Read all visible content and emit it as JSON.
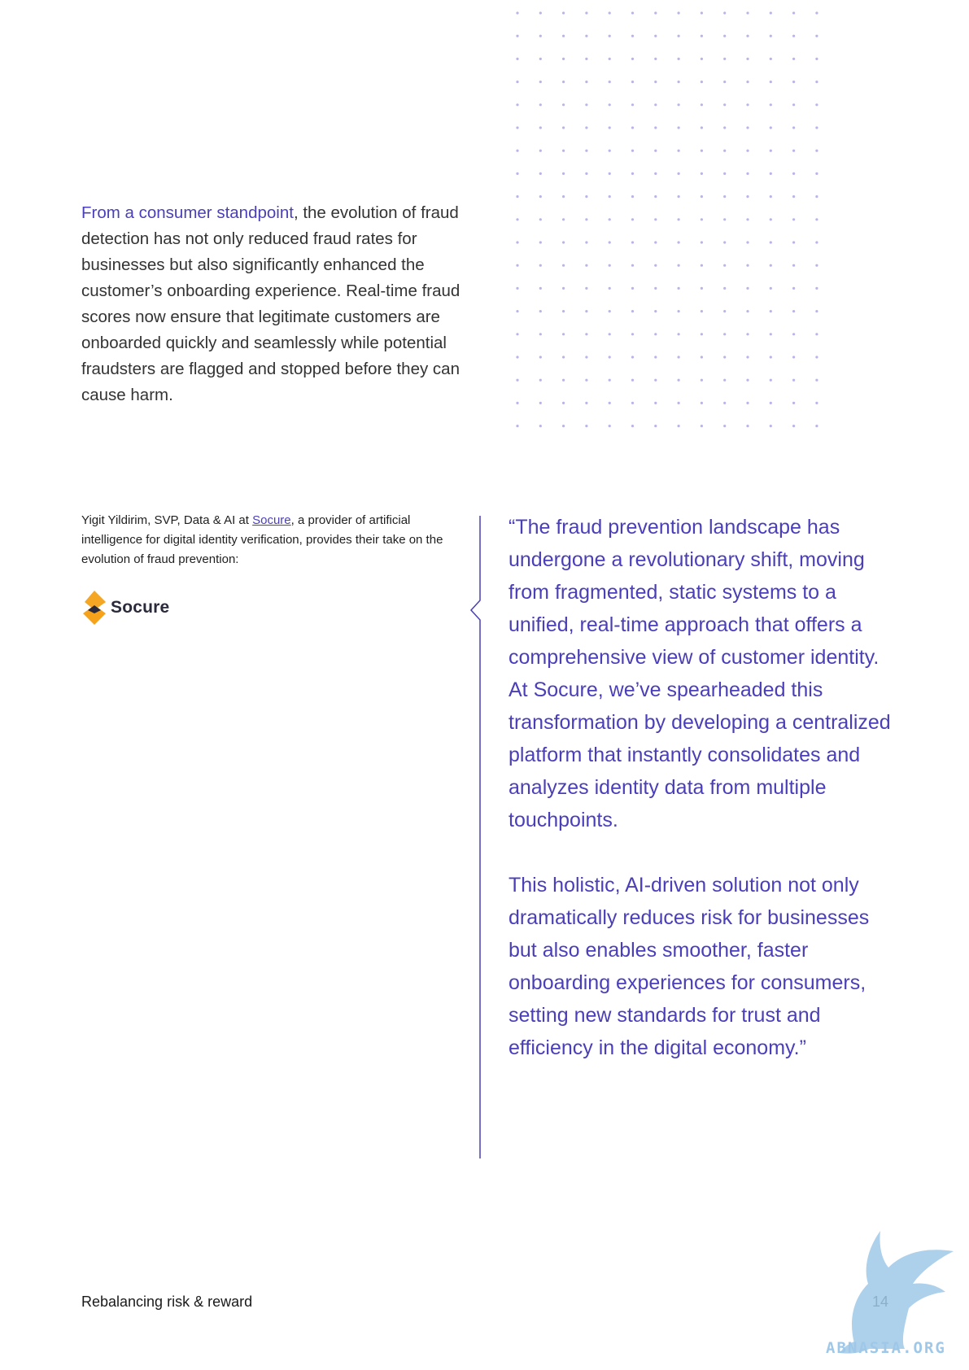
{
  "intro": {
    "lead": "From a consumer standpoint",
    "rest": ", the evolution of fraud detection has not only reduced fraud rates for businesses but also significantly enhanced the customer’s onboarding experience. Real-time fraud scores now ensure that legitimate customers are onboarded quickly and seamlessly while potential fraudsters are flagged and stopped before they can cause harm."
  },
  "attribution": {
    "before": "Yigit Yildirim, SVP, Data & AI at ",
    "link": "Socure",
    "after": ", a provider of artificial intelligence for digital identity verification, provides their take on the evolution of fraud prevention:"
  },
  "logo": {
    "name": "Socure",
    "mark_colors": [
      "#f5a623",
      "#f7c04a"
    ]
  },
  "quote": {
    "paragraph1": "“The fraud prevention landscape has undergone a revolutionary shift, moving from fragmented, static systems to a unified, real-time approach that offers a comprehensive view of customer identity. At Socure, we’ve spearheaded this transformation by developing a centralized platform that instantly consolidates and analyzes identity data from multiple touchpoints.",
    "paragraph2": "This holistic, AI-driven solution not only dramatically reduces risk for businesses but also enables smoother, faster onboarding experiences for consumers, setting new standards for trust and efficiency in the digital economy.”"
  },
  "footer": {
    "title": "Rebalancing risk & reward",
    "page_number": "14"
  },
  "watermark": {
    "text": "ABNASIA.ORG",
    "icon": "griffin-icon"
  },
  "colors": {
    "accent": "#4a3fb8",
    "dots": "#b9b4ea",
    "text": "#333333",
    "watermark": "#9fc8e8"
  }
}
